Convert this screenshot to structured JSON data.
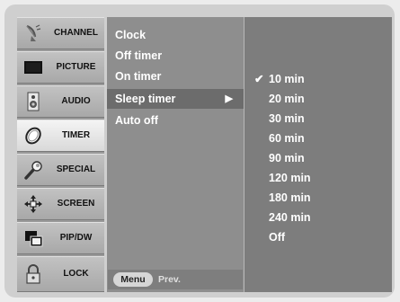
{
  "categories": [
    {
      "label": "CHANNEL",
      "icon": "satellite-dish-icon"
    },
    {
      "label": "PICTURE",
      "icon": "tv-screen-icon"
    },
    {
      "label": "AUDIO",
      "icon": "speaker-icon"
    },
    {
      "label": "TIMER",
      "icon": "clock-icon"
    },
    {
      "label": "SPECIAL",
      "icon": "wrench-icon"
    },
    {
      "label": "SCREEN",
      "icon": "move-arrows-icon"
    },
    {
      "label": "PIP/DW",
      "icon": "pip-windows-icon"
    },
    {
      "label": "LOCK",
      "icon": "padlock-icon"
    }
  ],
  "selected_category": "TIMER",
  "submenu": {
    "items": [
      {
        "label": "Clock"
      },
      {
        "label": "Off timer"
      },
      {
        "label": "On timer"
      },
      {
        "label": "Sleep timer",
        "arrow": "▶"
      },
      {
        "label": "Auto off"
      }
    ],
    "highlighted": "Sleep timer",
    "footer": {
      "menu_label": "Menu",
      "prev_label": "Prev."
    }
  },
  "options": {
    "checkmark": "✔",
    "items": [
      "10 min",
      "20 min",
      "30 min",
      "60 min",
      "90 min",
      "120 min",
      "180 min",
      "240 min",
      "Off"
    ],
    "selected": "10 min"
  },
  "colors": {
    "frame": "#cfcfcf",
    "submenu_bg": "#8e8e8e",
    "options_bg": "#7d7d7d",
    "highlight": "#6c6c6c"
  }
}
